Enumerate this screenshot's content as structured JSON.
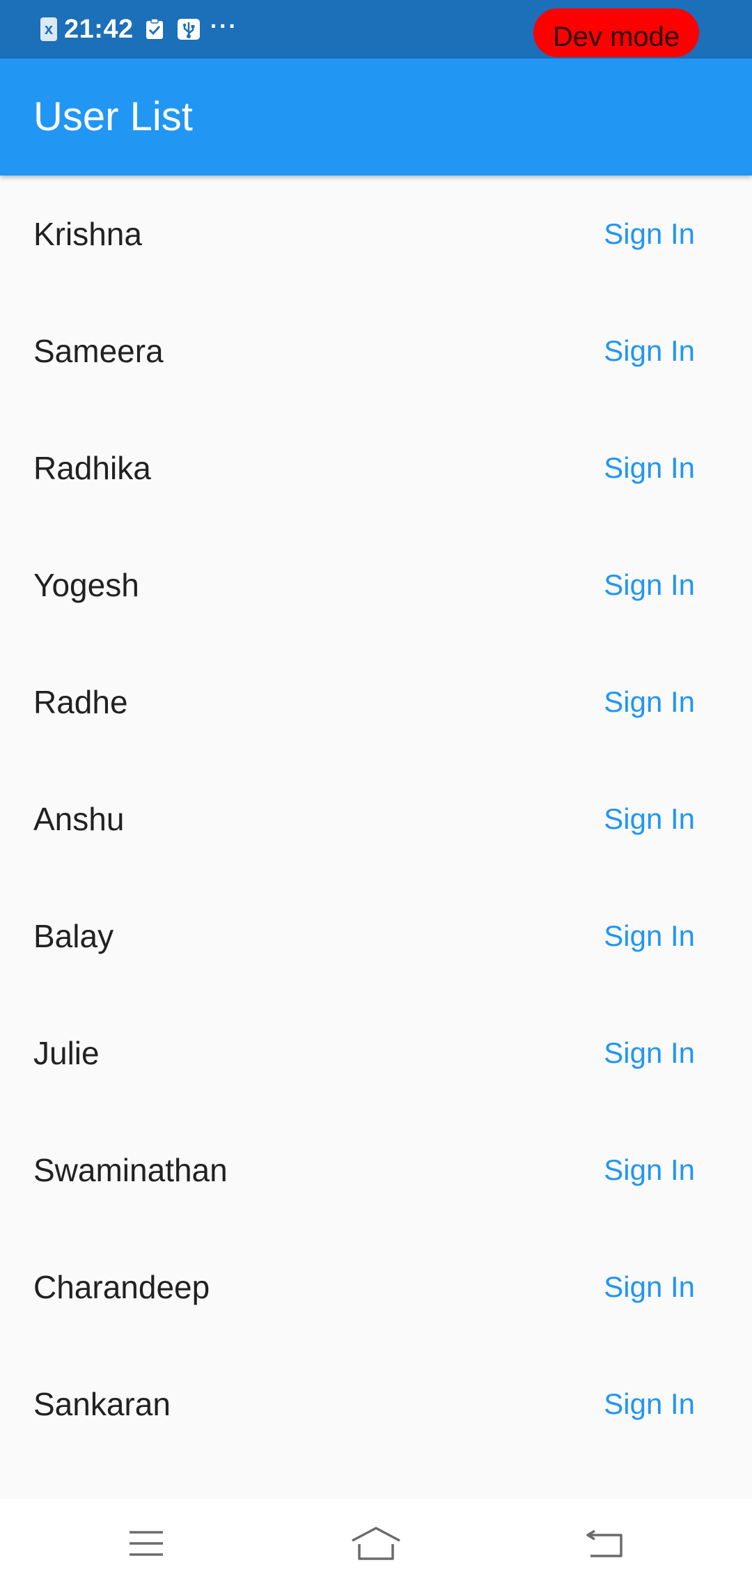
{
  "status_bar": {
    "time": "21:42",
    "sim_label": "x",
    "more": "···",
    "dev_mode_label": "Dev mode"
  },
  "app_bar": {
    "title": "User List"
  },
  "users": [
    {
      "name": "Krishna",
      "action": "Sign In"
    },
    {
      "name": "Sameera",
      "action": "Sign In"
    },
    {
      "name": "Radhika",
      "action": "Sign In"
    },
    {
      "name": "Yogesh",
      "action": "Sign In"
    },
    {
      "name": "Radhe",
      "action": "Sign In"
    },
    {
      "name": "Anshu",
      "action": "Sign In"
    },
    {
      "name": "Balay",
      "action": "Sign In"
    },
    {
      "name": "Julie",
      "action": "Sign In"
    },
    {
      "name": "Swaminathan",
      "action": "Sign In"
    },
    {
      "name": "Charandeep",
      "action": "Sign In"
    },
    {
      "name": "Sankaran",
      "action": "Sign In"
    }
  ],
  "nav_bar": {
    "icons": [
      "menu-icon",
      "home-icon",
      "back-icon"
    ]
  },
  "colors": {
    "status_bar": "#1c6fb9",
    "app_bar": "#2196f3",
    "accent": "#2196f3",
    "dev_badge": "#ff0000",
    "background": "#fafafa"
  }
}
